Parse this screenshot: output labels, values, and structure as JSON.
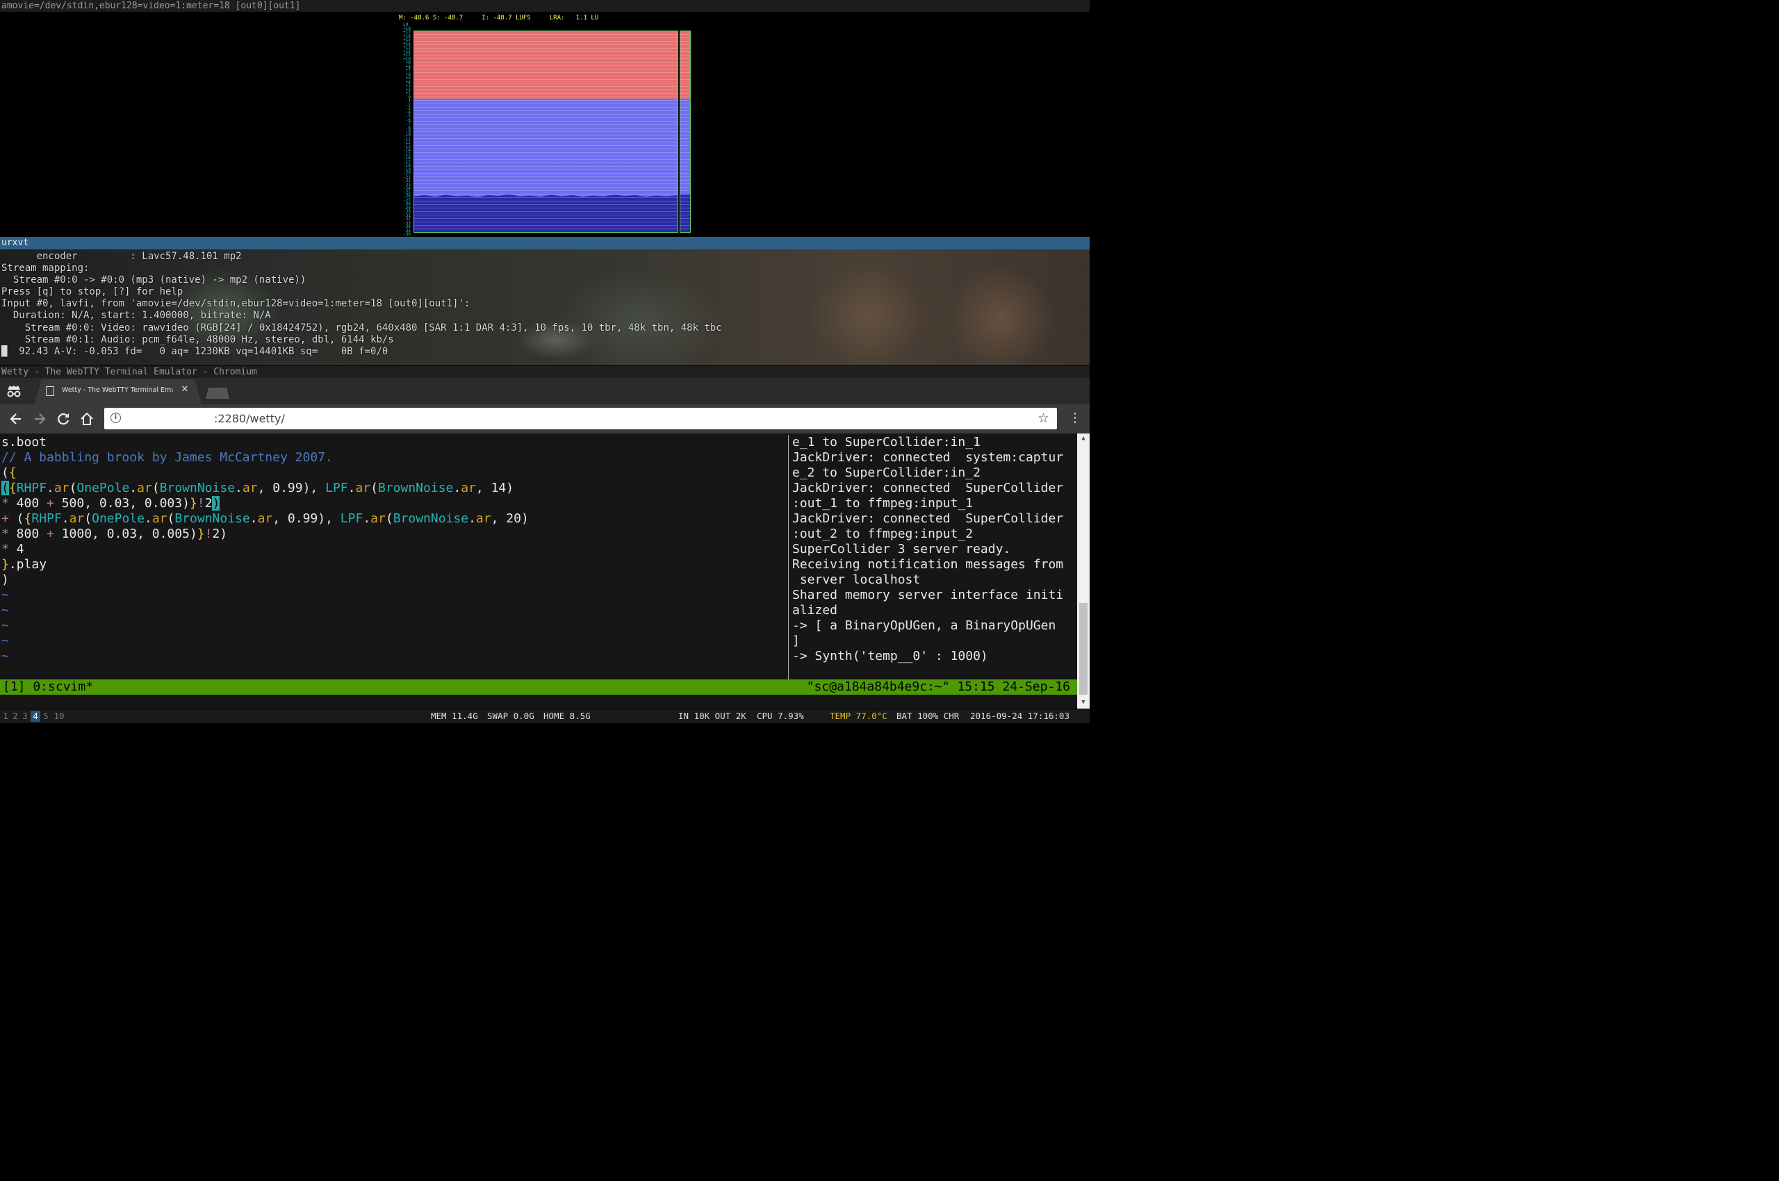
{
  "windows": {
    "top": {
      "title": "amovie=/dev/stdin,ebur128=video=1:meter=18 [out0][out1]",
      "meter": {
        "readout": "M: -48.6 S: -48.7     I: -48.7 LUFS     LRA:   1.1 LU",
        "unit_label": "LU",
        "scale_labels": [
          "+18",
          "+17",
          "+16",
          "+15",
          "+14",
          "+13",
          "+12",
          "+11",
          "+10",
          "+9",
          "+8",
          "+7",
          "+6",
          "+5",
          "+4",
          "+3",
          "+2",
          "+1",
          "0",
          "-1",
          "-2",
          "-3",
          "-4",
          "-5",
          "-6",
          "-7",
          "-8",
          "-9",
          "-10",
          "-11",
          "-12",
          "-13",
          "-14",
          "-15",
          "-16",
          "-17",
          "-18",
          "-19",
          "-20",
          "-21",
          "-22",
          "-23",
          "-24",
          "-25",
          "-26",
          "-27",
          "-28",
          "-29",
          "-30",
          "-31",
          "-32",
          "-33",
          "-34",
          "-35",
          "-36"
        ],
        "colors": {
          "above_target": "#e67070",
          "below_target": "#6f6ff0",
          "level_fill": "#2b2ba6",
          "frame": "#66cc66",
          "readout": "#ffff55",
          "scale": "#2ec4c4"
        }
      }
    },
    "urxvt": {
      "title": "urxvt",
      "lines": [
        "      encoder         : Lavc57.48.101 mp2",
        "Stream mapping:",
        "  Stream #0:0 -> #0:0 (mp3 (native) -> mp2 (native))",
        "Press [q] to stop, [?] for help",
        "Input #0, lavfi, from 'amovie=/dev/stdin,ebur128=video=1:meter=18 [out0][out1]':",
        "  Duration: N/A, start: 1.400000, bitrate: N/A",
        "    Stream #0:0: Video: rawvideo (RGB[24] / 0x18424752), rgb24, 640x480 [SAR 1:1 DAR 4:3], 10 fps, 10 tbr, 48k tbn, 48k tbc",
        "    Stream #0:1: Audio: pcm_f64le, 48000 Hz, stereo, dbl, 6144 kb/s",
        "█  92.43 A-V: -0.053 fd=   0 aq= 1230KB vq=14401KB sq=    0B f=0/0"
      ]
    },
    "chromium": {
      "title": "Wetty - The WebTTY Terminal Emulator - Chromium",
      "tab_title": "Wetty - The WebTTY Terminal Emulator",
      "url": ":2280/wetty/",
      "icons": {
        "incognito": "incognito-icon",
        "back": "back-arrow-icon",
        "forward": "forward-arrow-icon",
        "reload": "reload-icon",
        "home": "home-icon",
        "info": "info-icon",
        "star": "star-icon",
        "menu": "menu-icon"
      }
    }
  },
  "vim": {
    "line1": "s.boot",
    "line2": "// A babbling brook by James McCartney 2007.",
    "tildes": [
      "~",
      "~",
      "~",
      "~",
      "~"
    ]
  },
  "post_window": {
    "lines": [
      "e_1 to SuperCollider:in_1",
      "JackDriver: connected  system:captur",
      "e_2 to SuperCollider:in_2",
      "JackDriver: connected  SuperCollider",
      ":out_1 to ffmpeg:input_1",
      "JackDriver: connected  SuperCollider",
      ":out_2 to ffmpeg:input_2",
      "SuperCollider 3 server ready.",
      "Receiving notification messages from",
      " server localhost",
      "Shared memory server interface initi",
      "alized",
      "-> [ a BinaryOpUGen, a BinaryOpUGen",
      "]",
      "-> Synth('temp__0' : 1000)"
    ]
  },
  "tmux": {
    "left": "[1] 0:scvim*",
    "right": "\"sc@a184a84b4e9c:~\" 15:15 24-Sep-16"
  },
  "statusbar": {
    "workspaces": [
      "1",
      "2",
      "3",
      "4",
      "5",
      "10"
    ],
    "active_workspace": "4",
    "mem": "MEM 11.4G",
    "swap": "SWAP 0.0G",
    "home": "HOME 8.5G",
    "net": "IN 10K OUT 2K",
    "cpu": "CPU 7.93%",
    "temp": "TEMP 77.0°C",
    "battery": "BAT 100% CHR",
    "datetime": "2016-09-24 17:16:03"
  }
}
